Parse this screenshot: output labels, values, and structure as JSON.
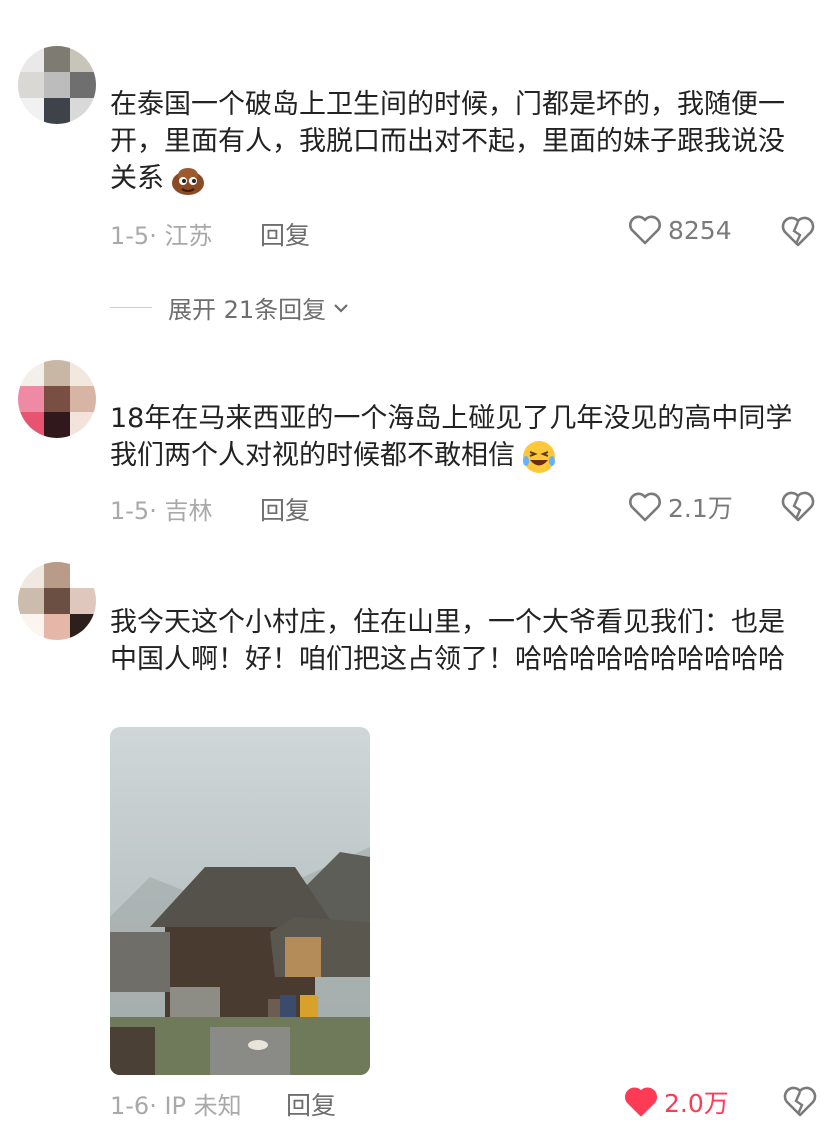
{
  "comments": [
    {
      "text": "在泰国一个破岛上卫生间的时候，门都是坏的，我随便一开，里面有人，我脱口而出对不起，里面的妹子跟我说没关系",
      "meta": "1-5· 江苏",
      "reply_label": "回复",
      "likes": "8254",
      "liked": false,
      "expand_label": "展开 21条回复"
    },
    {
      "text": "18年在马来西亚的一个海岛上碰见了几年没见的高中同学 我们两个人对视的时候都不敢相信",
      "meta": "1-5· 吉林",
      "reply_label": "回复",
      "likes": "2.1万",
      "liked": false
    },
    {
      "text": "我今天这个小村庄，住在山里，一个大爷看见我们：也是中国人啊！好！咱们把这占领了！哈哈哈哈哈哈哈哈哈哈",
      "meta": "1-6· IP 未知",
      "reply_label": "回复",
      "likes": "2.0万",
      "liked": true
    }
  ],
  "colors": {
    "like_active": "#ff3a55",
    "meta": "#a9a9a9"
  },
  "icons": {
    "like": "heart-outline-icon",
    "liked": "heart-filled-icon",
    "dislike": "broken-heart-icon",
    "expand": "chevron-down-icon",
    "emoji1": "poop-emoji-icon",
    "emoji2": "laughing-emoji-icon"
  }
}
